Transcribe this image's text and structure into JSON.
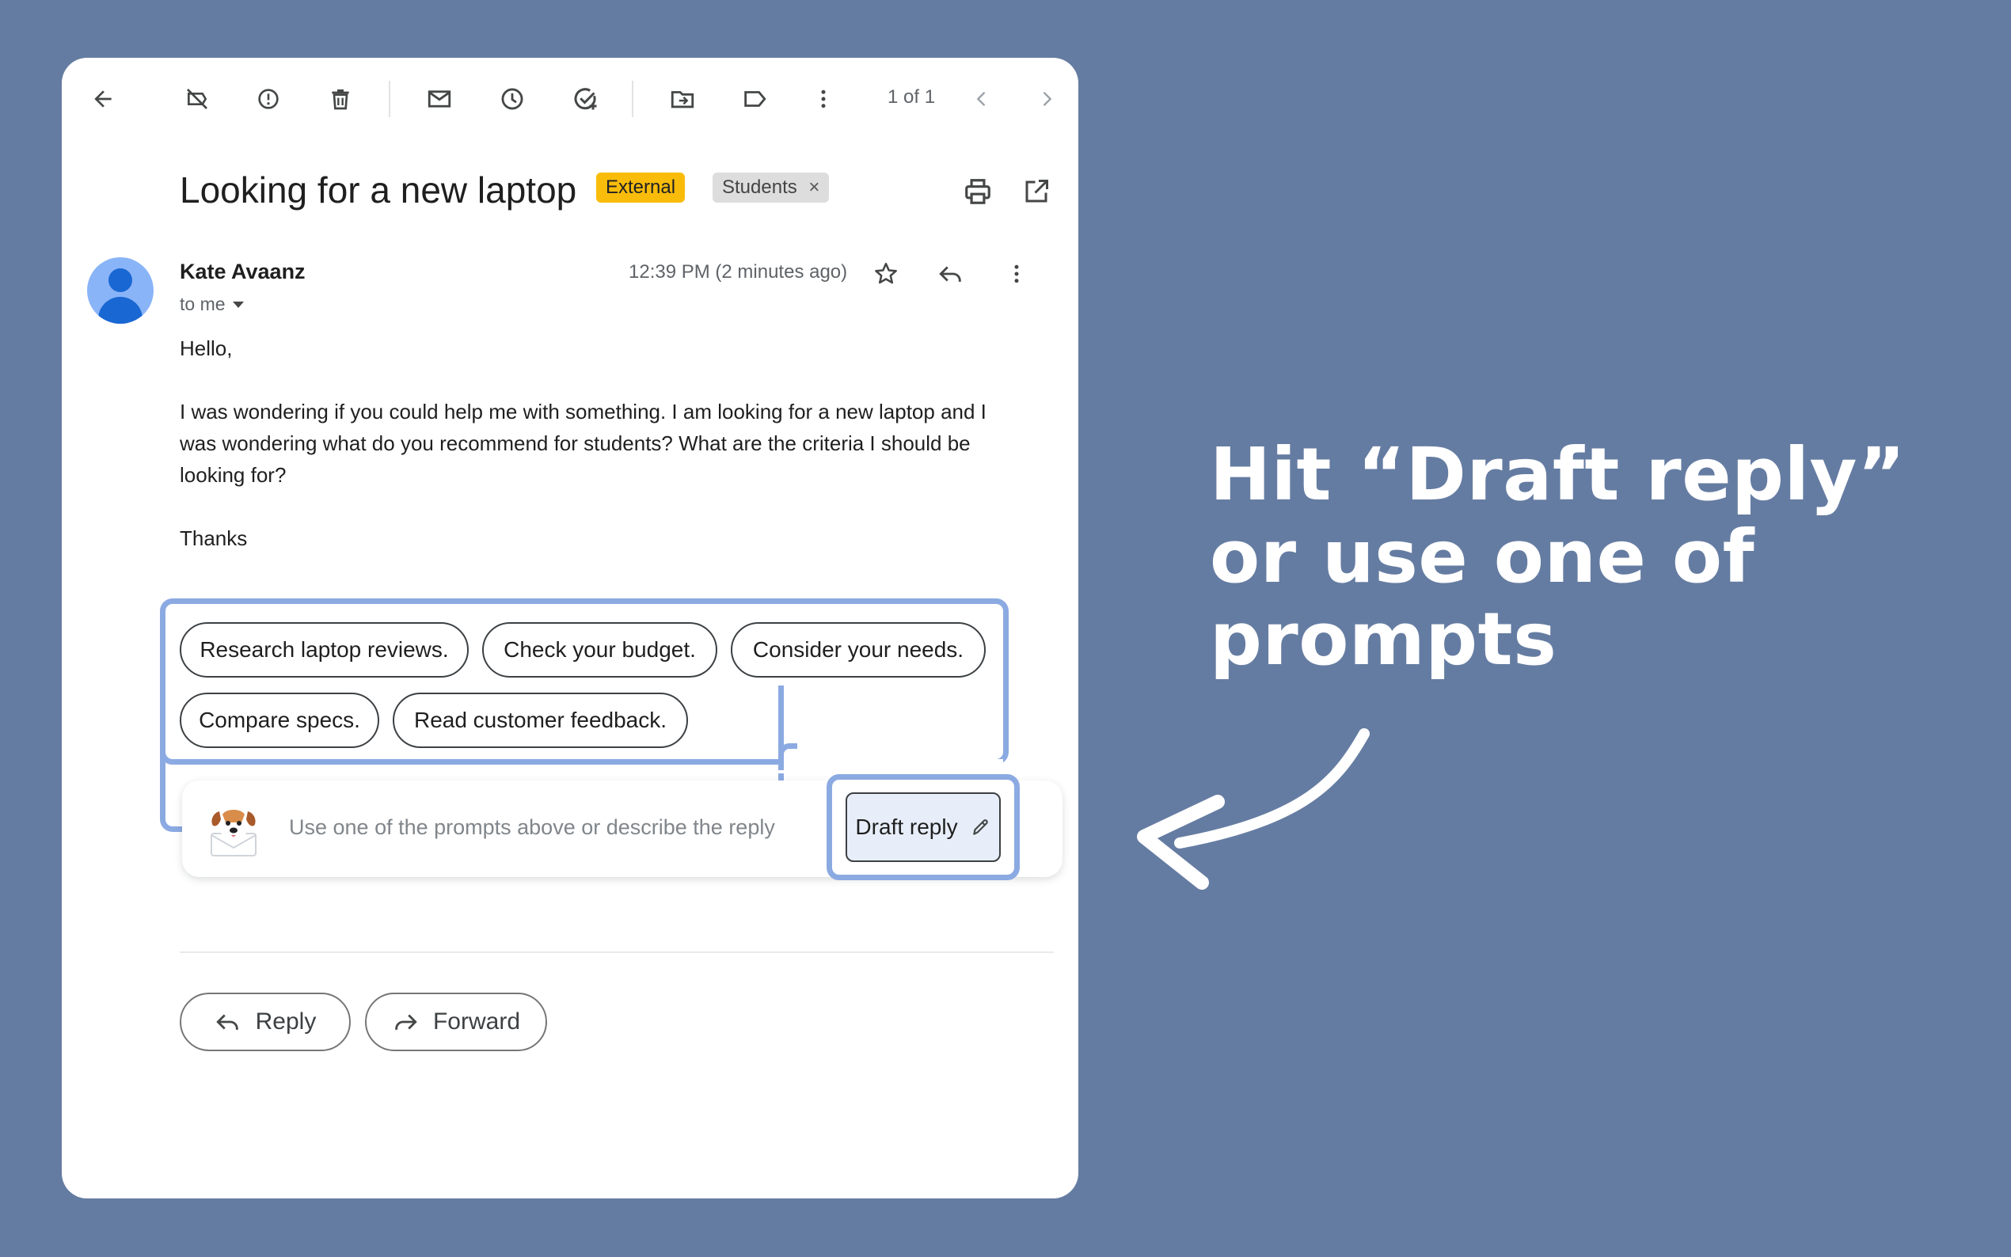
{
  "toolbar": {
    "page_count": "1 of 1",
    "icons": [
      "back-arrow-icon",
      "archive-off-icon",
      "report-spam-icon",
      "delete-icon",
      "mark-unread-icon",
      "snooze-icon",
      "add-task-icon",
      "move-to-icon",
      "label-icon",
      "more-vert-icon",
      "chevron-left-icon",
      "chevron-right-icon"
    ]
  },
  "email": {
    "subject": "Looking for a new laptop",
    "labels": {
      "external": "External",
      "students": "Students"
    },
    "sender": "Kate Avaanz",
    "recipient": "to me",
    "time": "12:39 PM (2 minutes ago)",
    "body": {
      "greeting": "Hello,",
      "paragraph": "I was wondering if you could help me with something. I am looking for a new laptop and I was wondering what do you recommend for students? What are the criteria I should be looking for?",
      "signoff": "Thanks"
    }
  },
  "prompts": [
    "Research laptop reviews.",
    "Check your budget.",
    "Consider your needs.",
    "Compare specs.",
    "Read customer feedback."
  ],
  "composer": {
    "placeholder": "Use one of the prompts above or describe the reply",
    "draft_label": "Draft reply"
  },
  "actions": {
    "reply": "Reply",
    "forward": "Forward"
  },
  "callout": {
    "line1": "Hit “Draft reply”",
    "line2": "or use one of",
    "line3": "prompts"
  },
  "colors": {
    "background": "#657CA2",
    "highlight": "#8CAAE2",
    "external_tag": "#F9BC0B",
    "students_tag": "#DDDDDD",
    "avatar": "#8AB4F8"
  }
}
